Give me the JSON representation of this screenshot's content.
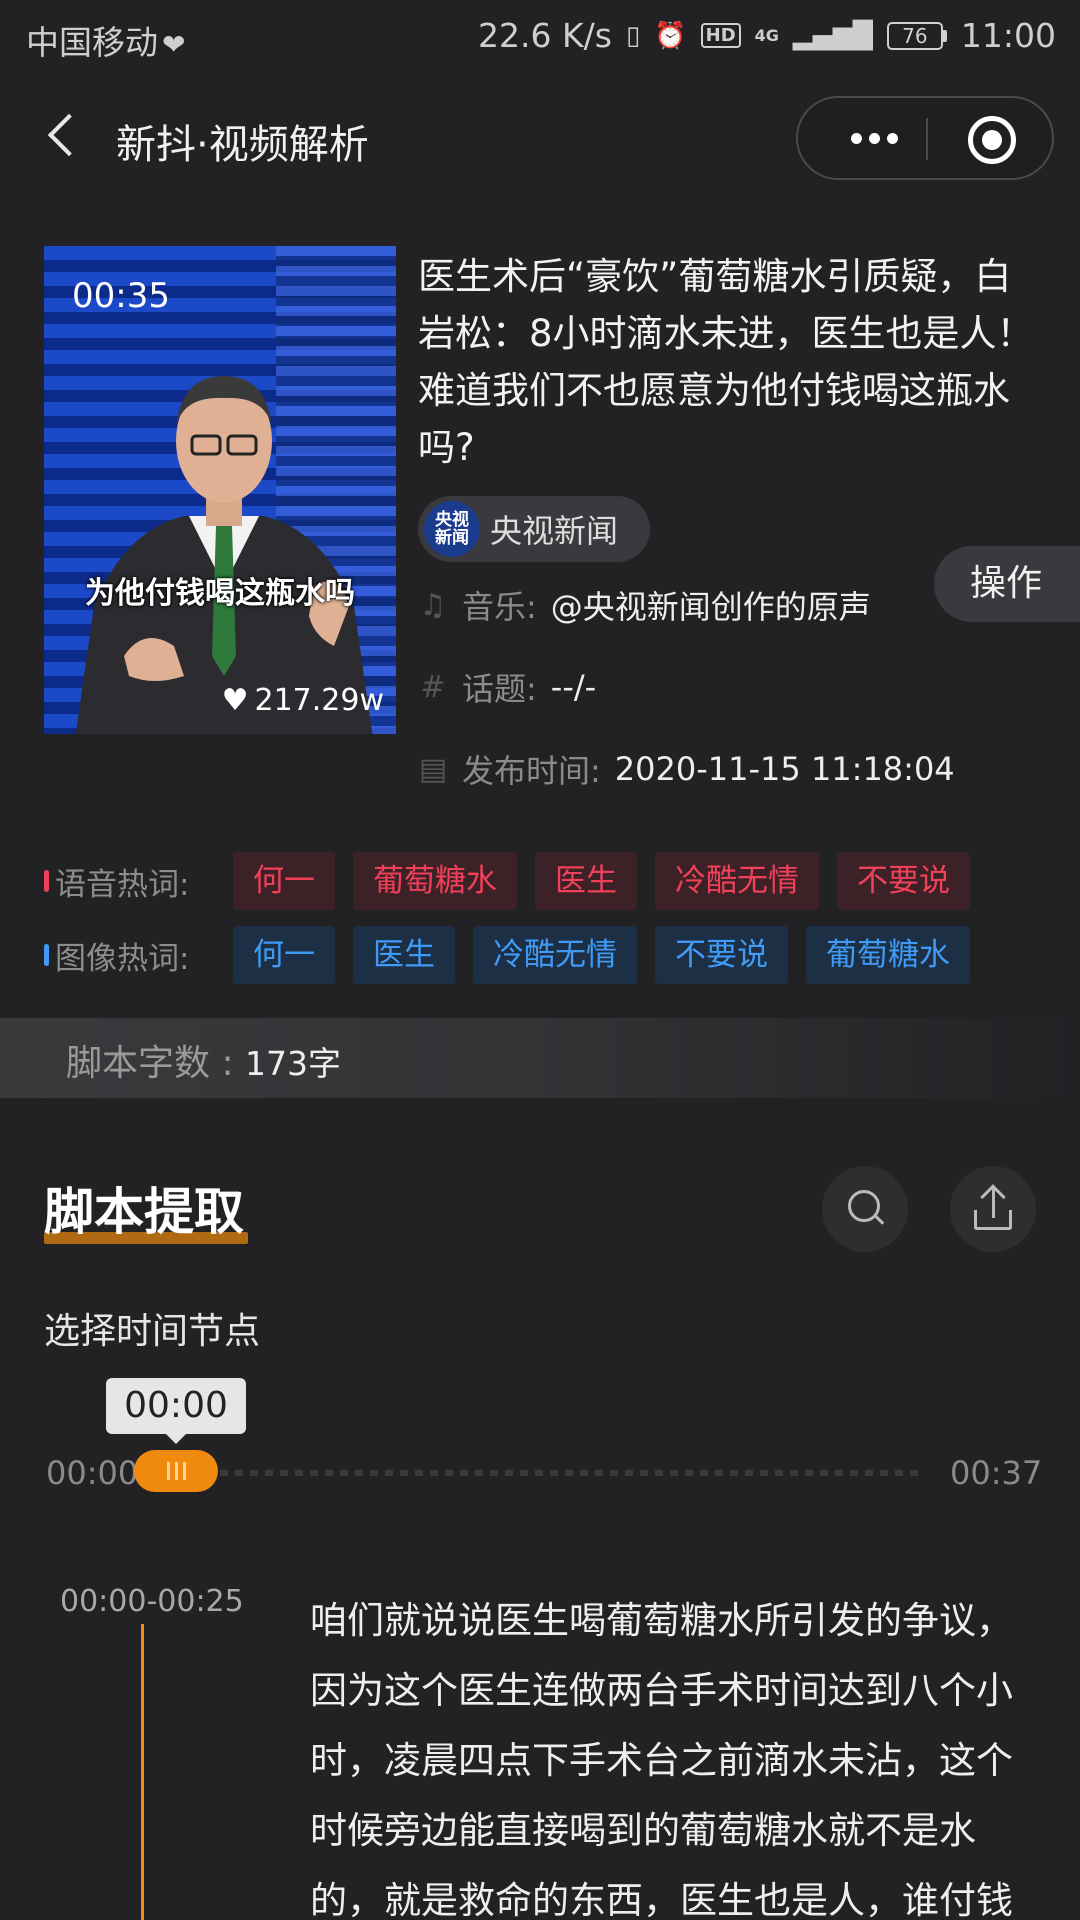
{
  "status_bar": {
    "carrier": "中国移动",
    "net_speed": "22.6 K/s",
    "signal_label": "4G",
    "hd_label": "HD",
    "battery": "76",
    "time": "11:00"
  },
  "nav": {
    "title": "新抖·视频解析"
  },
  "video": {
    "duration": "00:35",
    "caption": "为他付钱喝这瓶水吗",
    "likes": "217.29w",
    "title": "医生术后“豪饮”葡萄糖水引质疑，白岩松：8小时滴水未进，医生也是人！难道我们不也愿意为他付钱喝这瓶水吗?",
    "author_badge": [
      "央视",
      "新闻"
    ],
    "author": "央视新闻",
    "music_label": "音乐:",
    "music_value": "@央视新闻创作的原声",
    "topic_label": "话题:",
    "topic_value": "--/-",
    "publish_label": "发布时间:",
    "publish_value": "2020-11-15 11:18:04",
    "operate_label": "操作"
  },
  "hot_words": {
    "voice_label": "语音热词:",
    "voice": [
      "何一",
      "葡萄糖水",
      "医生",
      "冷酷无情",
      "不要说"
    ],
    "image_label": "图像热词:",
    "image": [
      "何一",
      "医生",
      "冷酷无情",
      "不要说",
      "葡萄糖水"
    ]
  },
  "script_count": {
    "label": "脚本字数 : ",
    "value": "173字"
  },
  "script": {
    "title": "脚本提取",
    "select_time_label": "选择时间节点",
    "current_time": "00:00",
    "start_time": "00:00",
    "end_time": "00:37",
    "progress_fraction": 0.0,
    "segments": [
      {
        "time": "00:00-00:25",
        "text": "咱们就说说医生喝葡萄糖水所引发的争议，因为这个医生连做两台手术时间达到八个小时，凌晨四点下手术台之前滴水未沾，这个时候旁边能直接喝到的葡萄糖水就不是水的，就是救命的东西，医生也是人，谁付钱这种质疑不仅不包含对人关切"
      }
    ]
  },
  "colors": {
    "background": "#222225",
    "accent_orange": "#f08a0e",
    "tag_red": "#f0405a",
    "tag_blue": "#3f9bf5"
  }
}
